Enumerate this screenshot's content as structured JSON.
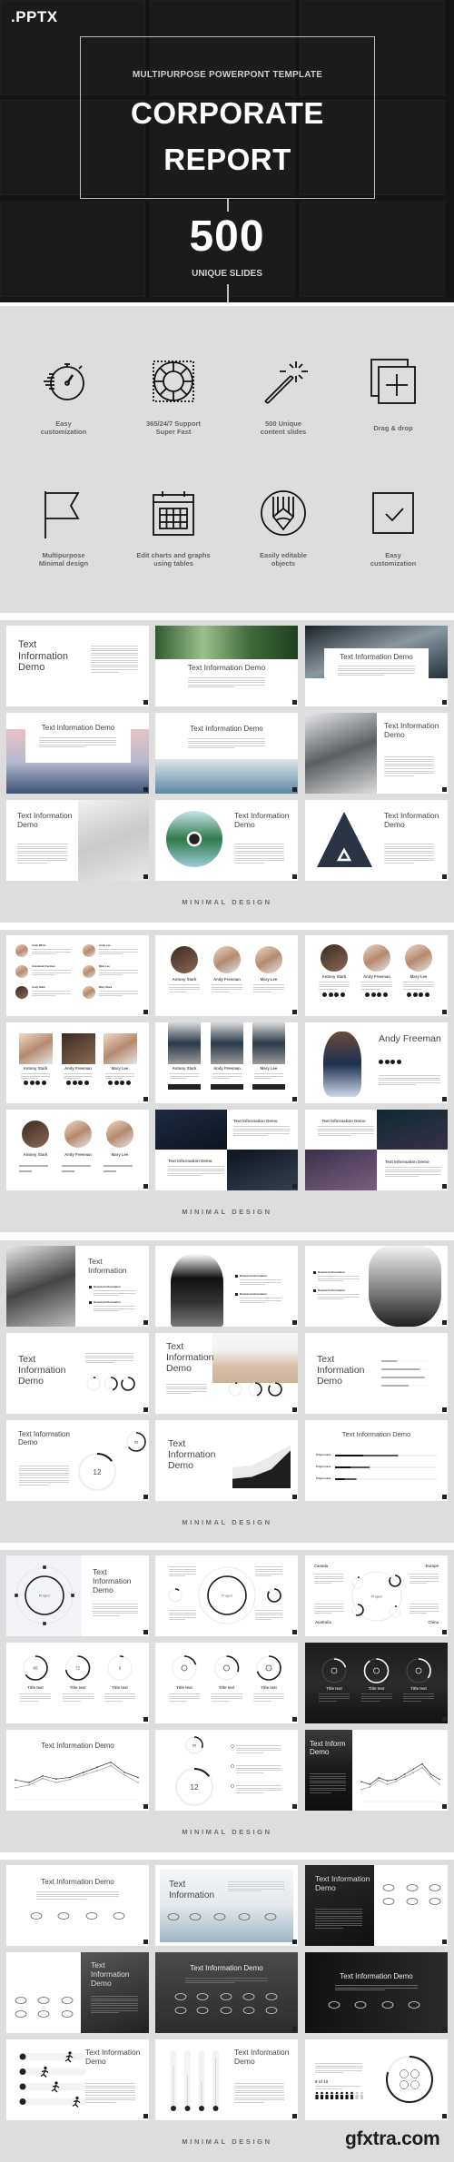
{
  "hero": {
    "format": ".PPTX",
    "subtitle": "MULTIPURPOSE POWERPONT TEMPLATE",
    "title": "CORPORATE\nREPORT",
    "count": "500",
    "count_label": "UNIQUE SLIDES"
  },
  "features": [
    {
      "icon": "stopwatch-icon",
      "label": "Easy\ncustomization"
    },
    {
      "icon": "lifebuoy-icon",
      "label": "365/24/7 Support\nSuper Fast"
    },
    {
      "icon": "magic-wand-icon",
      "label": "500 Unique\ncontent slides"
    },
    {
      "icon": "drag-drop-icon",
      "label": "Drag & drop"
    },
    {
      "icon": "flag-icon",
      "label": "Multipurpose\nMinimal design"
    },
    {
      "icon": "calendar-icon",
      "label": "Edit charts and graphs\nusing tables"
    },
    {
      "icon": "pencil-circle-icon",
      "label": "Easily editable\nobjects"
    },
    {
      "icon": "checkbox-icon",
      "label": "Easy\ncustomization"
    }
  ],
  "sections": [
    {
      "label": "MINIMAL DESIGN",
      "slides": [
        {
          "layout": "text-left",
          "title": "Text Information Demo"
        },
        {
          "layout": "img-top",
          "title": "Text Information Demo",
          "image_colors": [
            "#2f5a2f",
            "#9cc08a",
            "#3f6a3a",
            "#1f3f22"
          ]
        },
        {
          "layout": "img-top-card",
          "title": "Text Information Demo",
          "image_colors": [
            "#1a2228",
            "#8a98a2",
            "#22303a"
          ]
        },
        {
          "layout": "img-bottom-card",
          "title": "Text Information Demo",
          "image_colors": [
            "#e9c3c6",
            "#b7b9cc",
            "#3b5478"
          ]
        },
        {
          "layout": "img-bottom",
          "title": "Text Information Demo",
          "image_colors": [
            "#dfe6ea",
            "#9fb7c6",
            "#5a86a3"
          ]
        },
        {
          "layout": "img-left",
          "title": "Text Information Demo",
          "image_colors": [
            "#e6e7e9",
            "#5b5f63",
            "#dcdcdc"
          ]
        },
        {
          "layout": "img-right",
          "title": "Text Information Demo",
          "image_colors": [
            "#f0f0f0",
            "#c9c9c9",
            "#e8e8e8"
          ]
        },
        {
          "layout": "circle-img",
          "title": "Text Information Demo",
          "image_colors": [
            "#c9e4ee",
            "#2f7a4a",
            "#9ccbd8"
          ]
        },
        {
          "layout": "triangle-img",
          "title": "Text Information Demo",
          "image_colors": [
            "#4a5a70",
            "#1c2430"
          ]
        }
      ]
    },
    {
      "label": "MINIMAL DESIGN",
      "slides": [
        {
          "layout": "people-list",
          "people": [
            "Andy White",
            "Andy Lee",
            "Anastasia Freeman",
            "Mike Lee",
            "Andy Stark",
            "Mary Stark"
          ]
        },
        {
          "layout": "people-circles",
          "people": [
            "Antony Stark",
            "Andy Freeman",
            "Mary Lee"
          ]
        },
        {
          "layout": "people-circles",
          "variant": "social",
          "people": [
            "Antony Stark",
            "Andy Freeman",
            "Mary Lee"
          ]
        },
        {
          "layout": "people-square",
          "people": [
            "Antony Stark",
            "Andy Freeman",
            "Mary Lee"
          ]
        },
        {
          "layout": "people-full",
          "people": [
            "Antony Stark",
            "Andy Freeman",
            "Mary Lee"
          ]
        },
        {
          "layout": "profile",
          "title": "Andy Freeman"
        },
        {
          "layout": "people-circles",
          "variant": "bars",
          "people": [
            "Antony Stark",
            "Andy Freeman",
            "Mary Lee"
          ]
        },
        {
          "layout": "quad",
          "titles": [
            "Text Information Demo",
            "Text Information Demo"
          ],
          "image_colors": [
            "#1d2b40",
            "#0e1420"
          ]
        },
        {
          "layout": "quad-mirror",
          "titles": [
            "Text Information Demo",
            "Text Information Demo"
          ],
          "image_colors": [
            "#0c2a30",
            "#3a3048"
          ]
        }
      ]
    },
    {
      "label": "MINIMAL DESIGN",
      "slides": [
        {
          "layout": "portrait-left-bullets",
          "title": "Text Information",
          "bullets": [
            "Detected information",
            "Detected information"
          ]
        },
        {
          "layout": "portrait-center-bullets",
          "bullets": [
            "Detected information",
            "Detected information"
          ]
        },
        {
          "layout": "bullets-portrait-right",
          "bullets": [
            "Detected information",
            "Detected information"
          ]
        },
        {
          "layout": "text-rings",
          "title": "Text Information Demo",
          "rings": [
            0.05,
            0.45,
            0.85
          ]
        },
        {
          "layout": "text-img-rings",
          "title": "Text Information Demo",
          "rings": [
            0.05,
            0.45,
            0.85
          ]
        },
        {
          "layout": "text-progress",
          "title": "Text Information Demo",
          "progress": [
            0.35,
            0.85,
            0.95,
            0.6
          ]
        },
        {
          "layout": "rings-12",
          "title": "Text Information Demo",
          "rings": [
            {
              "value": "65",
              "pct": 0.65
            },
            {
              "value": "12",
              "pct": 0.15
            }
          ]
        },
        {
          "layout": "text-area",
          "title": "Text Information Demo",
          "series": [
            [
              2.2,
              2.4,
              3.4,
              4.6
            ],
            [
              1.0,
              1.2,
              2.0,
              4.0
            ]
          ]
        },
        {
          "layout": "hbars",
          "title": "Text Information Demo",
          "rows": [
            {
              "label": "Project name",
              "value": 0.62
            },
            {
              "label": "Project name",
              "value": 0.34
            },
            {
              "label": "Project name",
              "value": 0.21
            }
          ]
        }
      ]
    },
    {
      "label": "MINIMAL DESIGN",
      "slides": [
        {
          "layout": "project-circle",
          "title": "Text Information Demo",
          "center": "Project"
        },
        {
          "layout": "project-two",
          "center": "Project"
        },
        {
          "layout": "regions",
          "center": "Project",
          "regions": [
            "Canada",
            "Europe",
            "Australia",
            "China"
          ]
        },
        {
          "layout": "rings-3",
          "caption": "Title text",
          "rings": [
            {
              "value": "65",
              "pct": 0.65
            },
            {
              "value": "72",
              "pct": 0.72
            },
            {
              "value": "5",
              "pct": 0.05
            }
          ]
        },
        {
          "layout": "rings-icons",
          "caption": "Title text",
          "rings": [
            {
              "icon": "brain-icon",
              "pct": 0.2
            },
            {
              "icon": "tools-icon",
              "pct": 0.3
            },
            {
              "icon": "anchor-icon",
              "pct": 0.7
            }
          ]
        },
        {
          "layout": "rings-icons-dark",
          "caption": "Title text",
          "rings": [
            {
              "icon": "tools-icon",
              "pct": 0.2
            },
            {
              "icon": "brain-icon",
              "pct": 0.9
            },
            {
              "icon": "anchor-icon",
              "pct": 0.35
            }
          ]
        },
        {
          "layout": "line-chart",
          "title": "Text Information Demo",
          "series": [
            [
              3.5,
              3.0,
              4.3,
              3.7,
              4.0,
              5.0,
              6.0,
              7.0,
              5.0,
              4.0
            ],
            [
              2.0,
              2.5,
              3.8,
              3.0,
              3.6,
              4.5,
              5.3,
              6.3,
              4.5,
              3.0
            ]
          ]
        },
        {
          "layout": "rings-list",
          "rings": [
            {
              "value": "65",
              "pct": 0.3
            },
            {
              "value": "12",
              "pct": 0.15
            }
          ]
        },
        {
          "layout": "dark-panel-line",
          "title": "Text Inform Demo",
          "series": [
            [
              3.5,
              3.0,
              4.3,
              3.7,
              4.0,
              5.0,
              6.0,
              7.0,
              5.0,
              4.0
            ],
            [
              2.0,
              2.5,
              3.8,
              3.0,
              3.6,
              4.5,
              5.3,
              6.3,
              4.5,
              3.0
            ]
          ]
        }
      ]
    },
    {
      "label": "MINIMAL DESIGN",
      "slides": [
        {
          "layout": "logos-center",
          "title": "Text Information Demo"
        },
        {
          "layout": "img-text-logos",
          "title": "Text Information",
          "image_colors": [
            "#f4f6f8",
            "#e3e8ec",
            "#9fb6c4"
          ]
        },
        {
          "layout": "dark-left-logos",
          "title": "Text Information Demo",
          "image_colors": [
            "#2a2a2a",
            "#111"
          ]
        },
        {
          "layout": "logos-left-dark-right",
          "title": "Text Information Demo",
          "image_colors": [
            "#555",
            "#222"
          ]
        },
        {
          "layout": "dark-full-logos",
          "title": "Text Information Demo",
          "image_colors": [
            "#4a4a4a",
            "#2c2c2c"
          ]
        },
        {
          "layout": "dark-full-logos2",
          "title": "Text Information Demo",
          "image_colors": [
            "#111",
            "#2a2a2a"
          ]
        },
        {
          "layout": "runners",
          "title": "Text Information Demo"
        },
        {
          "layout": "vbars",
          "title": "Text Information Demo",
          "bars": [
            0.78,
            0.6,
            0.48,
            0.92
          ]
        },
        {
          "layout": "people-count",
          "count_label": "8 of 10",
          "filled": 8,
          "total": 10
        }
      ]
    }
  ],
  "watermark": "gfxtra.com"
}
